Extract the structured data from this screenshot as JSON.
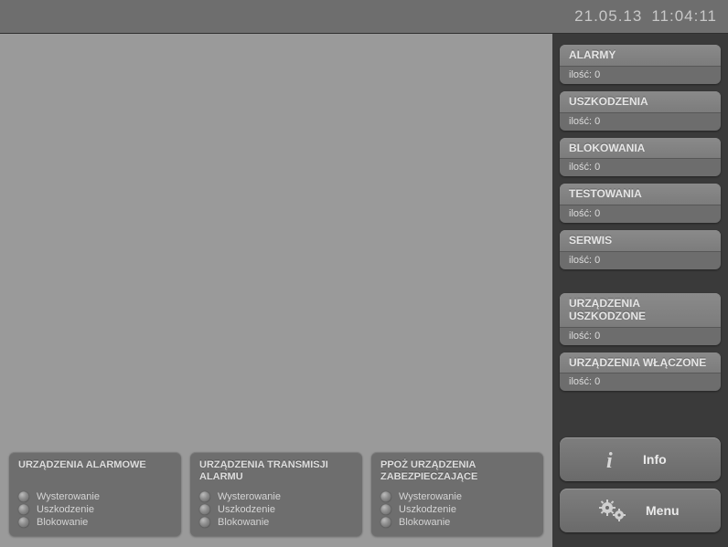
{
  "header": {
    "date": "21.05.13",
    "time": "11:04:11"
  },
  "status_panels": [
    {
      "title": "ALARMY",
      "count_label": "ilość: 0"
    },
    {
      "title": "USZKODZENIA",
      "count_label": "ilość: 0"
    },
    {
      "title": "BLOKOWANIA",
      "count_label": "ilość: 0"
    },
    {
      "title": "TESTOWANIA",
      "count_label": "ilość: 0"
    },
    {
      "title": "SERWIS",
      "count_label": "ilość: 0"
    }
  ],
  "device_panels": [
    {
      "title": "URZĄDZENIA USZKODZONE",
      "count_label": "ilość: 0"
    },
    {
      "title": "URZĄDZENIA WŁĄCZONE",
      "count_label": "ilość: 0"
    }
  ],
  "actions": {
    "info": "Info",
    "menu": "Menu"
  },
  "bottom_cards": [
    {
      "title": "URZĄDZENIA ALARMOWE",
      "states": [
        "Wysterowanie",
        "Uszkodzenie",
        "Blokowanie"
      ]
    },
    {
      "title": "URZĄDZENIA TRANSMISJI ALARMU",
      "states": [
        "Wysterowanie",
        "Uszkodzenie",
        "Blokowanie"
      ]
    },
    {
      "title": "PPOŻ URZĄDZENIA ZABEZPIECZAJĄCE",
      "states": [
        "Wysterowanie",
        "Uszkodzenie",
        "Blokowanie"
      ]
    }
  ]
}
